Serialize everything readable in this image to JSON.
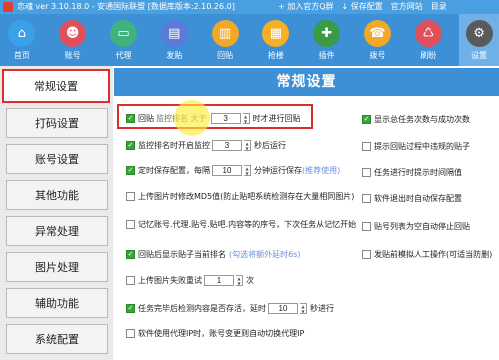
{
  "titlebar": {
    "title": "恋魂 ver 3.10.18.0 - 安通国际联盟 [数据库版本:2.10.26.0]",
    "actions": [
      "+ 加入官方Q群",
      "↓ 保存配置",
      "官方网站",
      "目录"
    ]
  },
  "toolbar": [
    {
      "label": "首页",
      "icon": "home-icon",
      "color": "#3aa0e8",
      "glyph": "⌂"
    },
    {
      "label": "账号",
      "icon": "user-icon",
      "color": "#e0505a",
      "glyph": "☻"
    },
    {
      "label": "代理",
      "icon": "monitor-icon",
      "color": "#3fb27f",
      "glyph": "▭"
    },
    {
      "label": "发贴",
      "icon": "document-icon",
      "color": "#5c7bd8",
      "glyph": "▤"
    },
    {
      "label": "回贴",
      "icon": "reply-doc-icon",
      "color": "#f0a826",
      "glyph": "▥"
    },
    {
      "label": "抢楼",
      "icon": "building-icon",
      "color": "#f5b026",
      "glyph": "▦"
    },
    {
      "label": "插件",
      "icon": "puzzle-icon",
      "color": "#3a9a45",
      "glyph": "✚"
    },
    {
      "label": "拨号",
      "icon": "phone-icon",
      "color": "#f0a826",
      "glyph": "☎"
    },
    {
      "label": "刷盼",
      "icon": "loop-icon",
      "color": "#e0505a",
      "glyph": "♺"
    },
    {
      "label": "设置",
      "icon": "gear-icon",
      "color": "#5a5a5a",
      "glyph": "⚙"
    }
  ],
  "sidebar": [
    "常规设置",
    "打码设置",
    "账号设置",
    "其他功能",
    "异常处理",
    "图片处理",
    "辅助功能",
    "系统配置"
  ],
  "main": {
    "title": "常规设置",
    "opts": {
      "o1": {
        "pre": "回贴",
        "post": "时才进行回贴",
        "val": "3"
      },
      "o2": {
        "pre": "监控排名时开启监控",
        "post": "秒后运行",
        "val": "3"
      },
      "o3": {
        "pre": "定时保存配置，每隔",
        "mid": "分钟运行保存",
        "hint": "(推荐使用)",
        "val": "10"
      },
      "o4": {
        "text": "上传图片时修改MD5值(防止贴吧系统检测存在大量相同图片)"
      },
      "o5": {
        "text": "记忆账号.代理.贴号.贴吧.内容等的序号，下次任务从记忆开始"
      },
      "o6": {
        "pre": "回贴后显示贴子当前排名",
        "hint": "(勾选将额外延时6s)"
      },
      "o7": {
        "pre": "上传图片失败重试",
        "post": "次",
        "val": "1"
      },
      "o8": {
        "pre": "任务完毕后检测内容是否存活，延时",
        "post": "秒进行",
        "val": "10"
      },
      "o9": {
        "text": "软件使用代理IP时，账号变更则自动切换代理IP"
      },
      "r1": {
        "text": "显示总任务次数与成功次数"
      },
      "r2": {
        "text": "提示回贴过程中违规的贴子"
      },
      "r3": {
        "text": "任务进行时提示时间隔值"
      },
      "r4": {
        "text": "软件退出时自动保存配置"
      },
      "r5": {
        "text": "贴号列表为空自动停止回贴"
      },
      "r6": {
        "text": "发贴前模拟人工操作(可适当防删)"
      }
    }
  }
}
